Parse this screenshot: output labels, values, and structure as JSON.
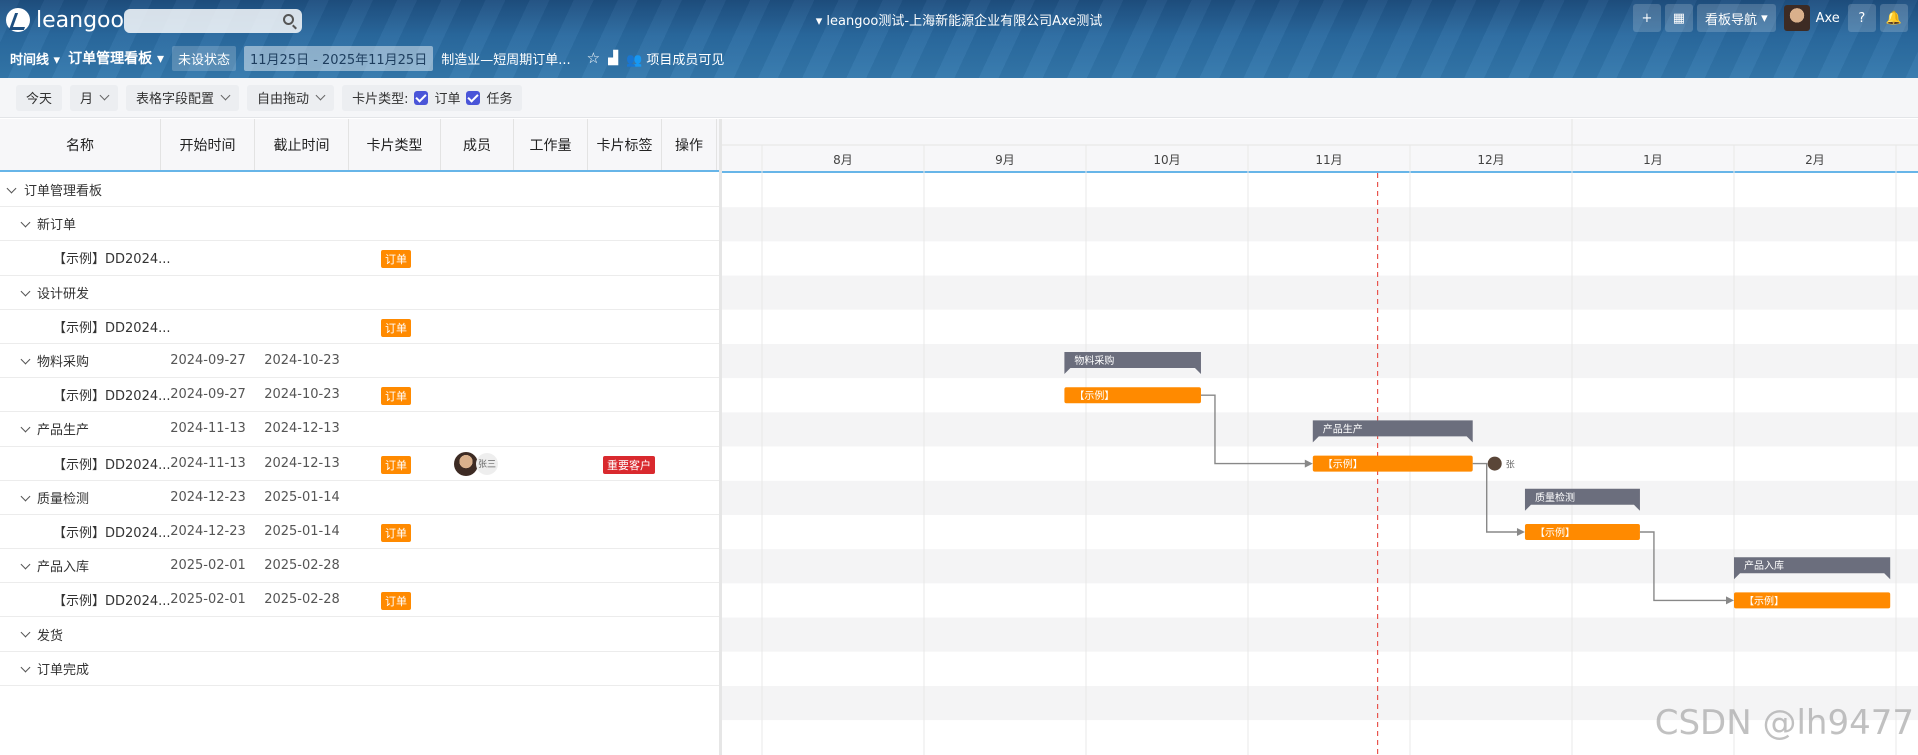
{
  "header": {
    "brand": "leangoo",
    "window_title": "leangoo测试-上海新能源企业有限公司Axe测试",
    "add_label": "+",
    "nav_label": "看板导航",
    "user_name": "Axe",
    "help_label": "?",
    "view_label": "时间线",
    "board_title": "订单管理看板",
    "status_label": "未设状态",
    "date_range": "11月25日 - 2025年11月25日",
    "board_name": "制造业—短周期订单...",
    "visibility_label": "项目成员可见"
  },
  "toolbar": {
    "today": "今天",
    "scale": "月",
    "field_config": "表格字段配置",
    "drag_mode": "自由拖动",
    "card_type_label": "卡片类型:",
    "type_order": "订单",
    "type_task": "任务"
  },
  "table": {
    "columns": [
      "名称",
      "开始时间",
      "截止时间",
      "卡片类型",
      "成员",
      "工作量",
      "卡片标签",
      "操作"
    ],
    "rows": [
      {
        "level": 0,
        "name": "订单管理看板",
        "start": "",
        "end": "",
        "type": "",
        "member": "",
        "tag": ""
      },
      {
        "level": 1,
        "name": "新订单",
        "start": "",
        "end": "",
        "type": "",
        "member": "",
        "tag": ""
      },
      {
        "level": 2,
        "name": "【示例】DD2024...",
        "start": "",
        "end": "",
        "type": "订单",
        "member": "",
        "tag": ""
      },
      {
        "level": 1,
        "name": "设计研发",
        "start": "",
        "end": "",
        "type": "",
        "member": "",
        "tag": ""
      },
      {
        "level": 2,
        "name": "【示例】DD2024...",
        "start": "",
        "end": "",
        "type": "订单",
        "member": "",
        "tag": ""
      },
      {
        "level": 1,
        "name": "物料采购",
        "start": "2024-09-27",
        "end": "2024-10-23",
        "type": "",
        "member": "",
        "tag": ""
      },
      {
        "level": 2,
        "name": "【示例】DD2024...",
        "start": "2024-09-27",
        "end": "2024-10-23",
        "type": "订单",
        "member": "",
        "tag": ""
      },
      {
        "level": 1,
        "name": "产品生产",
        "start": "2024-11-13",
        "end": "2024-12-13",
        "type": "",
        "member": "",
        "tag": ""
      },
      {
        "level": 2,
        "name": "【示例】DD2024...",
        "start": "2024-11-13",
        "end": "2024-12-13",
        "type": "订单",
        "member": "张三",
        "tag": "重要客户"
      },
      {
        "level": 1,
        "name": "质量检测",
        "start": "2024-12-23",
        "end": "2025-01-14",
        "type": "",
        "member": "",
        "tag": ""
      },
      {
        "level": 2,
        "name": "【示例】DD2024...",
        "start": "2024-12-23",
        "end": "2025-01-14",
        "type": "订单",
        "member": "",
        "tag": ""
      },
      {
        "level": 1,
        "name": "产品入库",
        "start": "2025-02-01",
        "end": "2025-02-28",
        "type": "",
        "member": "",
        "tag": ""
      },
      {
        "level": 2,
        "name": "【示例】DD2024...",
        "start": "2025-02-01",
        "end": "2025-02-28",
        "type": "订单",
        "member": "",
        "tag": ""
      },
      {
        "level": 1,
        "name": "发货",
        "start": "",
        "end": "",
        "type": "",
        "member": "",
        "tag": ""
      },
      {
        "level": 1,
        "name": "订单完成",
        "start": "",
        "end": "",
        "type": "",
        "member": "",
        "tag": ""
      }
    ]
  },
  "gantt": {
    "months": [
      "8月",
      "9月",
      "10月",
      "11月",
      "12月",
      "1月",
      "2月"
    ],
    "bars": [
      {
        "row": 5,
        "kind": "group",
        "label": "物料采购",
        "start": "2024-09-27",
        "end": "2024-10-23"
      },
      {
        "row": 6,
        "kind": "task",
        "label": "【示例】",
        "start": "2024-09-27",
        "end": "2024-10-23"
      },
      {
        "row": 7,
        "kind": "group",
        "label": "产品生产",
        "start": "2024-11-13",
        "end": "2024-12-13"
      },
      {
        "row": 8,
        "kind": "task",
        "label": "【示例】",
        "start": "2024-11-13",
        "end": "2024-12-13",
        "member_initial": "张"
      },
      {
        "row": 9,
        "kind": "group",
        "label": "质量检测",
        "start": "2024-12-23",
        "end": "2025-01-14"
      },
      {
        "row": 10,
        "kind": "task",
        "label": "【示例】",
        "start": "2024-12-23",
        "end": "2025-01-14"
      },
      {
        "row": 11,
        "kind": "group",
        "label": "产品入库",
        "start": "2025-02-01",
        "end": "2025-02-28"
      },
      {
        "row": 12,
        "kind": "task",
        "label": "【示例】",
        "start": "2025-02-01",
        "end": "2025-02-28"
      }
    ],
    "dependencies": [
      [
        6,
        8
      ],
      [
        8,
        10
      ],
      [
        10,
        12
      ]
    ],
    "today": "2024-11-25",
    "colors": {
      "task": "#ff8a00",
      "group": "#6b6e7d",
      "today_line": "#e8554e",
      "link": "#888888"
    }
  },
  "watermark": "CSDN @lh9477"
}
